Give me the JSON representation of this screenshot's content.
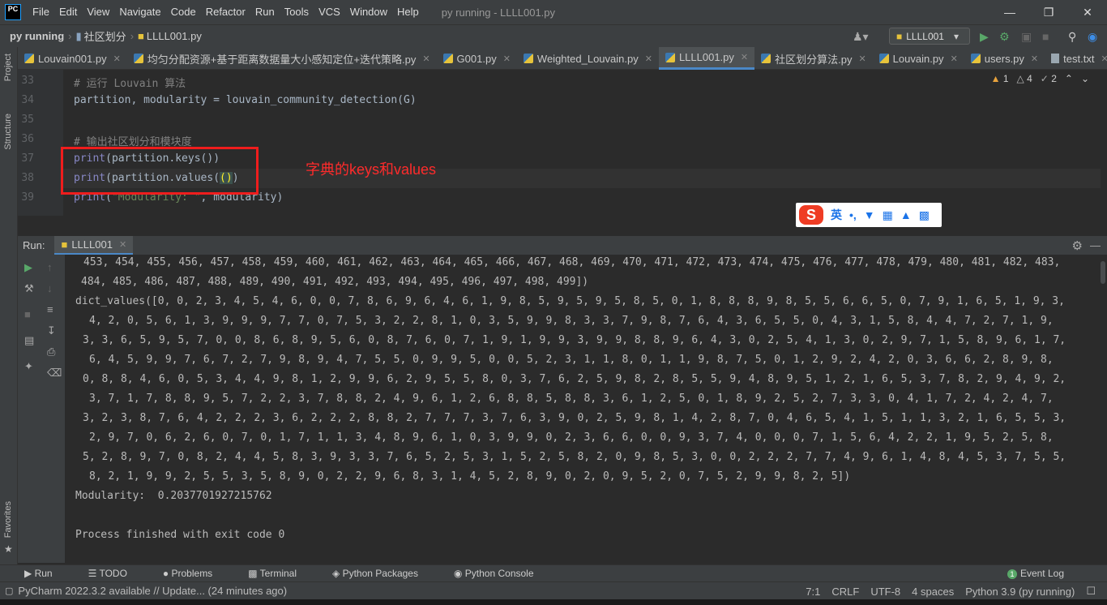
{
  "app": {
    "logo": "PC",
    "title": "py running - LLLL001.py"
  },
  "menu": [
    "File",
    "Edit",
    "View",
    "Navigate",
    "Code",
    "Refactor",
    "Run",
    "Tools",
    "VCS",
    "Window",
    "Help"
  ],
  "window_buttons": [
    "minimize-icon",
    "restore-icon",
    "close-icon"
  ],
  "breadcrumb": [
    "py running",
    "社区划分",
    "LLLL001.py"
  ],
  "run_config": "LLLL001",
  "tabs": [
    {
      "label": "Louvain001.py",
      "icon": "python-file-icon",
      "active": false
    },
    {
      "label": "均匀分配资源+基于距离数据量大小感知定位+迭代策略.py",
      "icon": "python-file-icon",
      "active": false
    },
    {
      "label": "G001.py",
      "icon": "python-file-icon",
      "active": false
    },
    {
      "label": "Weighted_Louvain.py",
      "icon": "python-file-icon",
      "active": false
    },
    {
      "label": "LLLL001.py",
      "icon": "python-file-icon",
      "active": true
    },
    {
      "label": "社区划分算法.py",
      "icon": "python-file-icon",
      "active": false
    },
    {
      "label": "Louvain.py",
      "icon": "python-file-icon",
      "active": false
    },
    {
      "label": "users.py",
      "icon": "python-file-icon",
      "active": false
    },
    {
      "label": "test.txt",
      "icon": "text-file-icon",
      "active": false
    }
  ],
  "left_strip": {
    "project": "Project",
    "structure": "Structure",
    "favorites": "Favorites"
  },
  "editor": {
    "line_numbers": [
      "33",
      "34",
      "35",
      "36",
      "37",
      "38",
      "39"
    ],
    "code": {
      "l33": "# 运行 Louvain 算法",
      "l34": "partition, modularity = louvain_community_detection(G)",
      "l36": "# 输出社区划分和模块度",
      "l37a": "print",
      "l37b": "(partition.keys())",
      "l38a": "print",
      "l38b": "(partition.values(",
      "l38c": "()",
      "l38d": ")",
      "l39a": "print",
      "l39b": "(",
      "l39c": "\"Modularity: \"",
      "l39d": ", modularity)"
    },
    "inspections": {
      "errors": "1",
      "warnings": "4",
      "weak": "2"
    },
    "annotation": "字典的keys和values"
  },
  "ime": {
    "logo": "S",
    "lang": "英"
  },
  "run": {
    "label": "Run:",
    "tab": "LLLL001"
  },
  "console": {
    "lines": [
      "453, 454, 455, 456, 457, 458, 459, 460, 461, 462, 463, 464, 465, 466, 467, 468, 469, 470, 471, 472, 473, 474, 475, 476, 477, 478, 479, 480, 481, 482, 483,",
      "484, 485, 486, 487, 488, 489, 490, 491, 492, 493, 494, 495, 496, 497, 498, 499])",
      "dict_values([0, 0, 2, 3, 4, 5, 4, 6, 0, 0, 7, 8, 6, 9, 6, 4, 6, 1, 9, 8, 5, 9, 5, 9, 5, 8, 5, 0, 1, 8, 8, 8, 9, 8, 5, 5, 6, 6, 5, 0, 7, 9, 1, 6, 5, 1, 9, 3,",
      "4, 2, 0, 5, 6, 1, 3, 9, 9, 9, 7, 7, 0, 7, 5, 3, 2, 2, 8, 1, 0, 3, 5, 9, 9, 8, 3, 3, 7, 9, 8, 7, 6, 4, 3, 6, 5, 5, 0, 4, 3, 1, 5, 8, 4, 4, 7, 2, 7, 1, 9,",
      "3, 3, 6, 5, 9, 5, 7, 0, 0, 8, 6, 8, 9, 5, 6, 0, 8, 7, 6, 0, 7, 1, 9, 1, 9, 9, 3, 9, 9, 8, 8, 9, 6, 4, 3, 0, 2, 5, 4, 1, 3, 0, 2, 9, 7, 1, 5, 8, 9, 6, 1, 7,",
      "6, 4, 5, 9, 9, 7, 6, 7, 2, 7, 9, 8, 9, 4, 7, 5, 5, 0, 9, 9, 5, 0, 0, 5, 2, 3, 1, 1, 8, 0, 1, 1, 9, 8, 7, 5, 0, 1, 2, 9, 2, 4, 2, 0, 3, 6, 6, 2, 8, 9, 8,",
      "0, 8, 8, 4, 6, 0, 5, 3, 4, 4, 9, 8, 1, 2, 9, 9, 6, 2, 9, 5, 5, 8, 0, 3, 7, 6, 2, 5, 9, 8, 2, 8, 5, 5, 9, 4, 8, 9, 5, 1, 2, 1, 6, 5, 3, 7, 8, 2, 9, 4, 9, 2,",
      "3, 7, 1, 7, 8, 8, 9, 5, 7, 2, 2, 3, 7, 8, 8, 2, 4, 9, 6, 1, 2, 6, 8, 8, 5, 8, 8, 3, 6, 1, 2, 5, 0, 1, 8, 9, 2, 5, 2, 7, 3, 3, 0, 4, 1, 7, 2, 4, 2, 4, 7,",
      "3, 2, 3, 8, 7, 6, 4, 2, 2, 2, 3, 6, 2, 2, 2, 8, 8, 2, 7, 7, 7, 3, 7, 6, 3, 9, 0, 2, 5, 9, 8, 1, 4, 2, 8, 7, 0, 4, 6, 5, 4, 1, 5, 1, 1, 3, 2, 1, 6, 5, 5, 3,",
      "2, 9, 7, 0, 6, 2, 6, 0, 7, 0, 1, 7, 1, 1, 3, 4, 8, 9, 6, 1, 0, 3, 9, 9, 0, 2, 3, 6, 6, 0, 0, 9, 3, 7, 4, 0, 0, 0, 7, 1, 5, 6, 4, 2, 2, 1, 9, 5, 2, 5, 8,",
      "5, 2, 8, 9, 7, 0, 8, 2, 4, 4, 5, 8, 3, 9, 3, 3, 7, 6, 5, 2, 5, 3, 1, 5, 2, 5, 8, 2, 0, 9, 8, 5, 3, 0, 0, 2, 2, 2, 7, 7, 4, 9, 6, 1, 4, 8, 4, 5, 3, 7, 5, 5,",
      "8, 2, 1, 9, 9, 2, 5, 5, 3, 5, 8, 9, 0, 2, 2, 9, 6, 8, 3, 1, 4, 5, 2, 8, 9, 0, 2, 0, 9, 5, 2, 0, 7, 5, 2, 9, 9, 8, 2, 5])",
      "Modularity:  0.2037701927215762",
      "",
      "Process finished with exit code 0"
    ]
  },
  "bottom_tabs": [
    "Run",
    "TODO",
    "Problems",
    "Terminal",
    "Python Packages",
    "Python Console"
  ],
  "event_log": "Event Log",
  "event_log_count": "1",
  "status": {
    "message": "PyCharm 2022.3.2 available // Update... (24 minutes ago)",
    "position": "7:1",
    "line_sep": "CRLF",
    "encoding": "UTF-8",
    "indent": "4 spaces",
    "interpreter": "Python 3.9 (py running)"
  }
}
